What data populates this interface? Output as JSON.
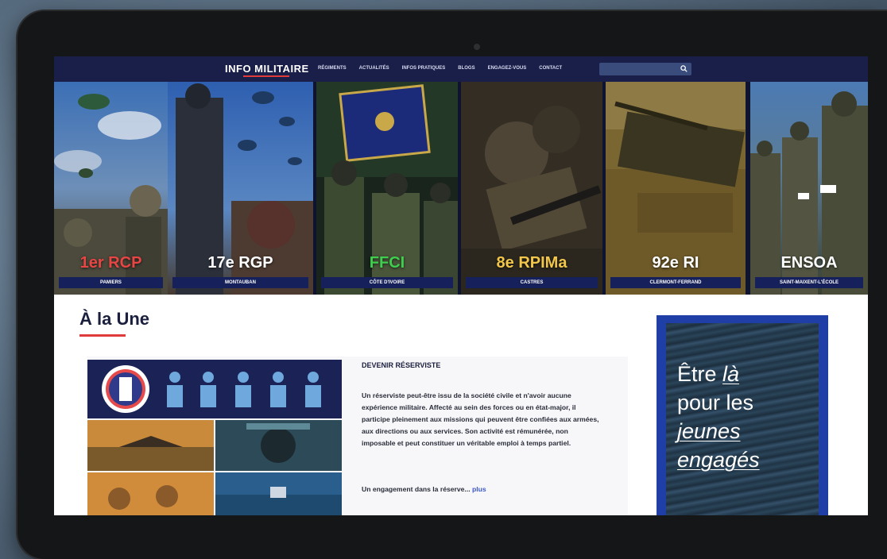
{
  "site": {
    "logo": "INFO MILITAIRE",
    "nav": [
      "Régiments",
      "Actualités",
      "Infos pratiques",
      "Blogs",
      "Engagez-vous",
      "Contact"
    ],
    "search_placeholder": ""
  },
  "hero": {
    "panels": [
      {
        "title": "1er RCP",
        "location": "Pamiers",
        "title_color": "#e84545"
      },
      {
        "title": "17e RGP",
        "location": "Montauban",
        "title_color": "#ffffff"
      },
      {
        "title": "FFCI",
        "location": "Côte d'Ivoire",
        "title_color": "#3fce4f"
      },
      {
        "title": "8e RPIMa",
        "location": "Castres",
        "title_color": "#f1c64a"
      },
      {
        "title": "92e RI",
        "location": "Clermont-Ferrand",
        "title_color": "#ffffff"
      },
      {
        "title": "ENSOA",
        "location": "Saint-Maixent-l'École",
        "title_color": "#ffffff"
      }
    ]
  },
  "main": {
    "section_title": "À la Une",
    "article": {
      "heading": "Devenir réserviste",
      "body": "Un réserviste peut-être issu de la société civile et n'avoir aucune expérience militaire. Affecté au sein des forces ou en état-major, il participe pleinement aux missions qui peuvent être confiées aux armées, aux directions ou aux services. Son activité est rémunérée, non imposable et peut constituer un véritable emploi à temps partiel.",
      "teaser": "Un engagement dans la réserve...",
      "more_label": "plus"
    },
    "promo": {
      "line1": "Être ",
      "line1_em": "là",
      "line2": "pour les",
      "line3_em": "jeunes",
      "line4_em": "engagés"
    }
  },
  "colors": {
    "nav_bg": "#1a1f4a",
    "accent_red": "#e03b3b",
    "promo_frame": "#1f3fa6",
    "location_bar": "#16205a"
  }
}
